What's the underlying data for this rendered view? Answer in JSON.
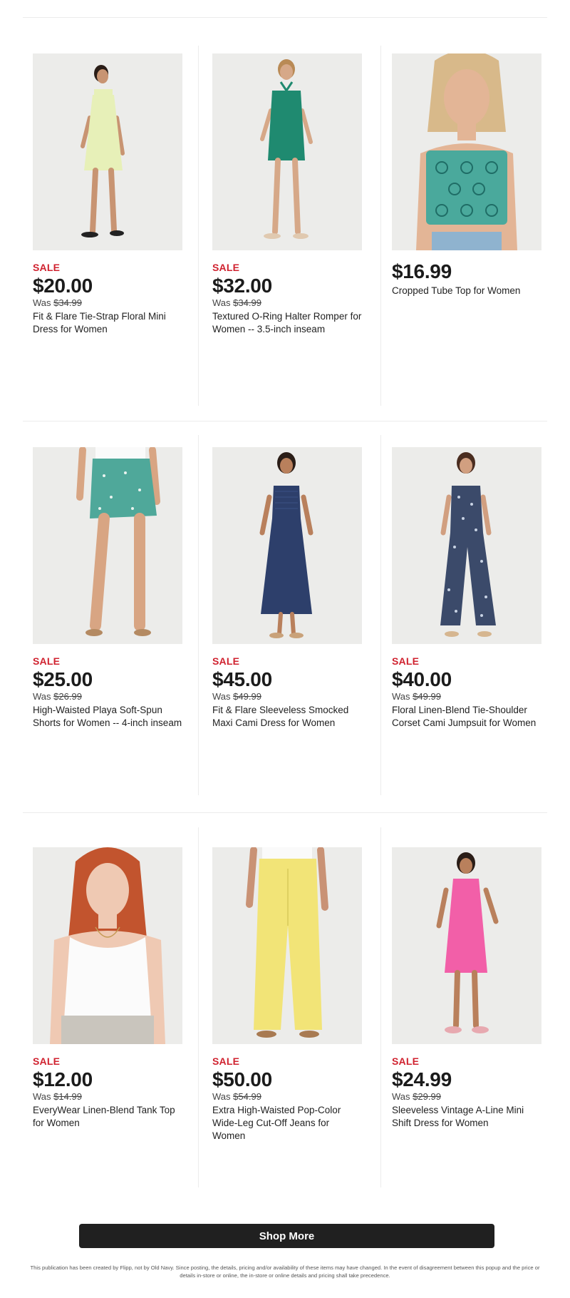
{
  "products": [
    {
      "flag": "SALE",
      "price": "$20.00",
      "was_label": "Was",
      "was_price": "$34.99",
      "title": "Fit & Flare Tie-Strap Floral Mini Dress for Women",
      "image": "model-in-pale-green-mini-dress"
    },
    {
      "flag": "SALE",
      "price": "$32.00",
      "was_label": "Was",
      "was_price": "$34.99",
      "title": "Textured O-Ring Halter Romper for Women -- 3.5-inch inseam",
      "image": "model-in-green-halter-romper"
    },
    {
      "flag": "",
      "price": "$16.99",
      "was_label": "",
      "was_price": "",
      "title": "Cropped Tube Top for Women",
      "image": "model-in-teal-print-tube-top"
    },
    {
      "flag": "SALE",
      "price": "$25.00",
      "was_label": "Was",
      "was_price": "$26.99",
      "title": "High-Waisted Playa Soft-Spun Shorts for Women -- 4-inch inseam",
      "image": "model-in-teal-print-shorts"
    },
    {
      "flag": "SALE",
      "price": "$45.00",
      "was_label": "Was",
      "was_price": "$49.99",
      "title": "Fit & Flare Sleeveless Smocked Maxi Cami Dress for Women",
      "image": "model-in-navy-maxi-dress"
    },
    {
      "flag": "SALE",
      "price": "$40.00",
      "was_label": "Was",
      "was_price": "$49.99",
      "title": "Floral Linen-Blend Tie-Shoulder Corset Cami Jumpsuit for Women",
      "image": "model-in-floral-jumpsuit"
    },
    {
      "flag": "SALE",
      "price": "$12.00",
      "was_label": "Was",
      "was_price": "$14.99",
      "title": "EveryWear Linen-Blend Tank Top for Women",
      "image": "model-in-white-tank-top"
    },
    {
      "flag": "SALE",
      "price": "$50.00",
      "was_label": "Was",
      "was_price": "$54.99",
      "title": "Extra High-Waisted Pop-Color Wide-Leg Cut-Off Jeans for Women",
      "image": "model-in-yellow-wide-leg-jeans"
    },
    {
      "flag": "SALE",
      "price": "$24.99",
      "was_label": "Was",
      "was_price": "$29.99",
      "title": "Sleeveless Vintage A-Line Mini Shift Dress for Women",
      "image": "model-in-pink-shift-dress"
    }
  ],
  "shop_more": {
    "label": "Shop More"
  },
  "disclaimer": "This publication has been created by Flipp, not by Old Navy. Since posting, the details, pricing and/or availability of these items may have changed. In the event of disagreement between this popup and the price or details in-store or online, the in-store or online details and pricing shall take precedence.",
  "colors": {
    "sale": "#d0222f",
    "button": "#202020",
    "rule": "#ececec",
    "photo_bg": "#ececea"
  }
}
